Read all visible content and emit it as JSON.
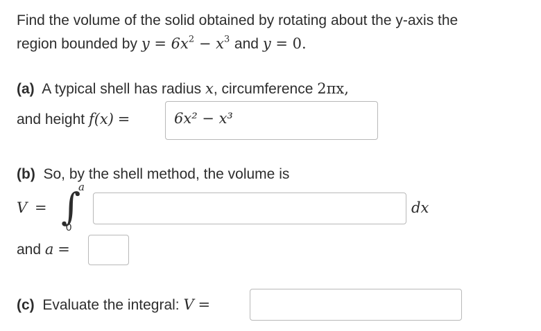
{
  "problem": {
    "line1": "Find the volume of the solid obtained by rotating about the y-axis the",
    "line2_prefix": "region bounded by",
    "eq1_lhs": "y",
    "eq1_rhs_a": "6x",
    "eq1_rhs_b": "x",
    "exp2": "2",
    "exp3": "3",
    "connector": "and",
    "eq2_lhs": "y",
    "eq2_rhs": "0."
  },
  "part_a": {
    "label": "(a)",
    "text": "A typical shell has radius",
    "radius_var": "x",
    "circ_label": ", circumference",
    "circ_value": "2πx,",
    "height_label": "and height",
    "f_expr": "f(x)",
    "equals": "=",
    "answer": "6x² − x³"
  },
  "part_b": {
    "label": "(b)",
    "text": "So, by the shell method, the volume is",
    "V_label": "V",
    "equals": "=",
    "upper_limit": "a",
    "lower_limit": "0",
    "integrand_value": "",
    "dx": "dx",
    "a_label_prefix": "and",
    "a_var": "a",
    "a_equals": "=",
    "a_value": ""
  },
  "part_c": {
    "label": "(c)",
    "text": "Evaluate the integral:",
    "V_label": "V",
    "equals": "=",
    "value": ""
  }
}
